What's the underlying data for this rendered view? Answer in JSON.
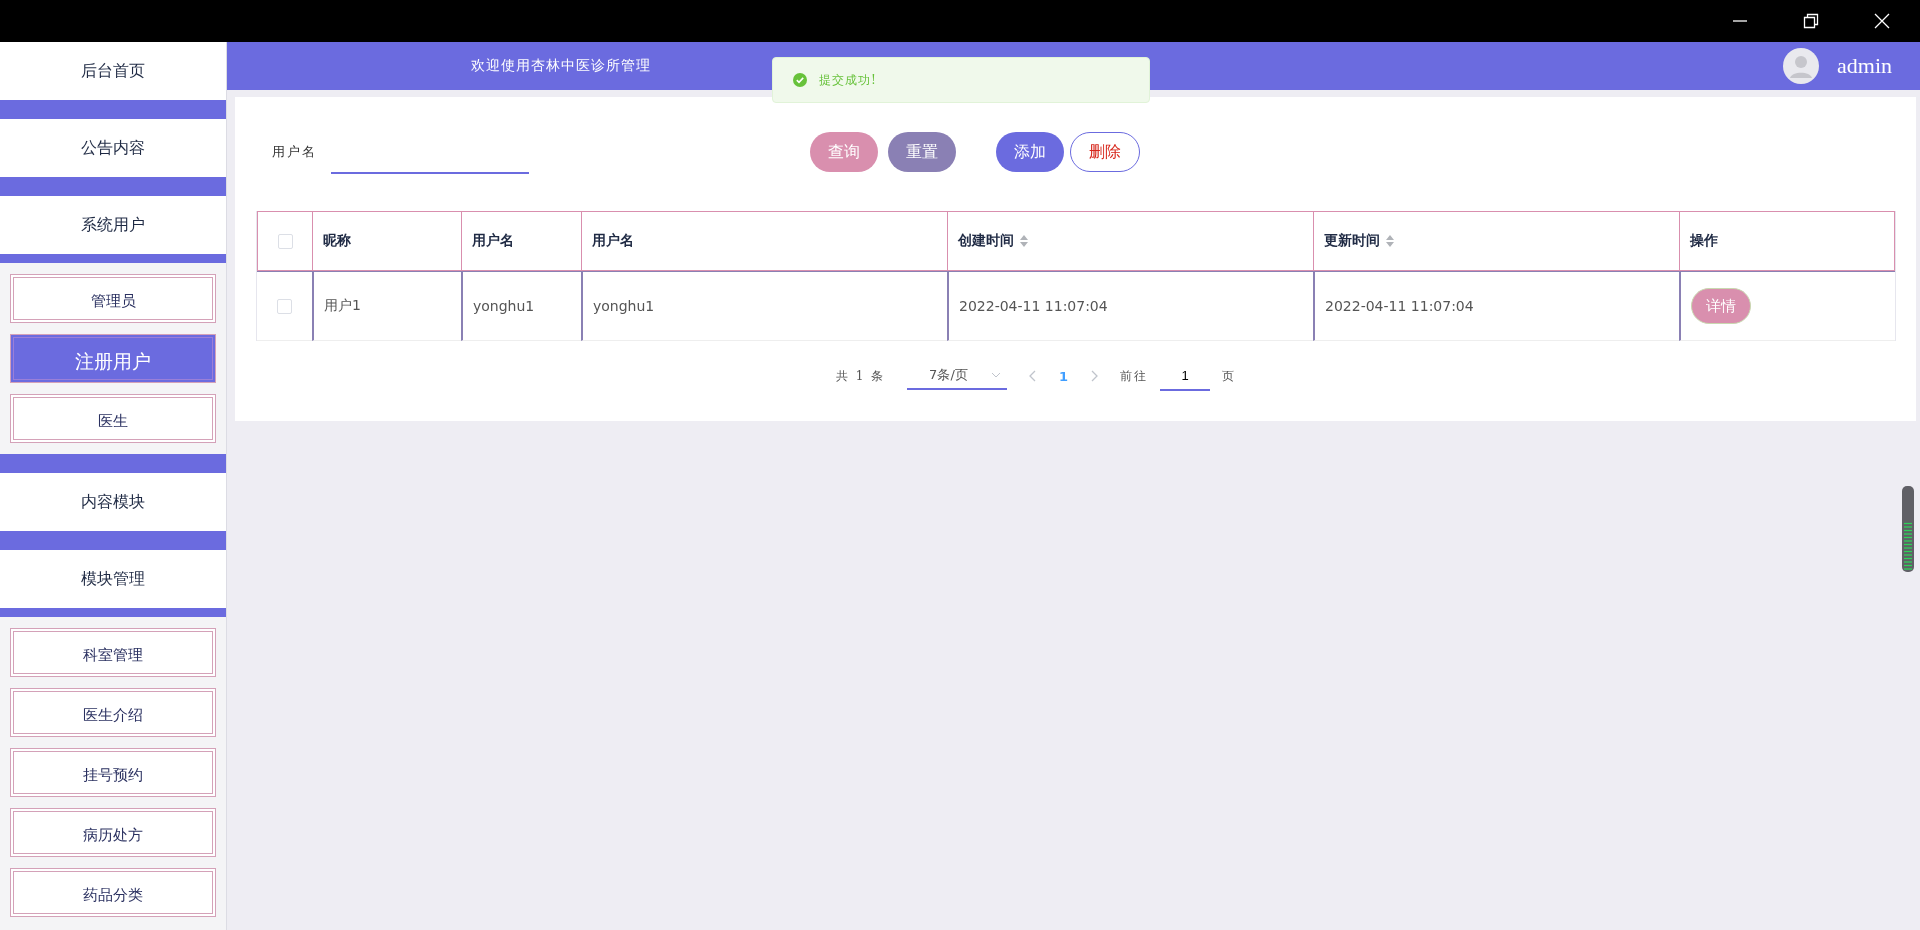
{
  "header": {
    "title": "欢迎使用杏林中医诊所管理",
    "user": "admin"
  },
  "toast": {
    "message": "提交成功!"
  },
  "sidebar": {
    "sections": [
      {
        "label": "后台首页"
      },
      {
        "label": "公告内容"
      },
      {
        "label": "系统用户",
        "children": [
          {
            "label": "管理员",
            "selected": false
          },
          {
            "label": "注册用户",
            "selected": true
          },
          {
            "label": "医生",
            "selected": false
          }
        ]
      },
      {
        "label": "内容模块"
      },
      {
        "label": "模块管理",
        "children": [
          {
            "label": "科室管理",
            "selected": false
          },
          {
            "label": "医生介绍",
            "selected": false
          },
          {
            "label": "挂号预约",
            "selected": false
          },
          {
            "label": "病历处方",
            "selected": false
          },
          {
            "label": "药品分类",
            "selected": false
          }
        ]
      }
    ]
  },
  "search": {
    "label": "用户名",
    "buttons": [
      {
        "label": "查询",
        "kind": "query"
      },
      {
        "label": "重置",
        "kind": "reset"
      },
      {
        "label": "添加",
        "kind": "add"
      },
      {
        "label": "删除",
        "kind": "delete"
      }
    ]
  },
  "table": {
    "select_all_checked": false,
    "columns": [
      {
        "label": "昵称",
        "sortable": false
      },
      {
        "label": "用户名",
        "sortable": false
      },
      {
        "label": "用户名",
        "sortable": false
      },
      {
        "label": "创建时间",
        "sortable": true
      },
      {
        "label": "更新时间",
        "sortable": true
      },
      {
        "label": "操作",
        "sortable": false
      }
    ],
    "rows": [
      {
        "checked": false,
        "cells": [
          "用户1",
          "yonghu1",
          "yonghu1",
          "2022-04-11 11:07:04",
          "2022-04-11 11:07:04"
        ],
        "action": "详情"
      }
    ]
  },
  "pagination": {
    "total": "共 1 条",
    "page_size": "7条/页",
    "current": "1",
    "goto_label": "前往",
    "goto_value": "1",
    "goto_suffix": "页"
  }
}
